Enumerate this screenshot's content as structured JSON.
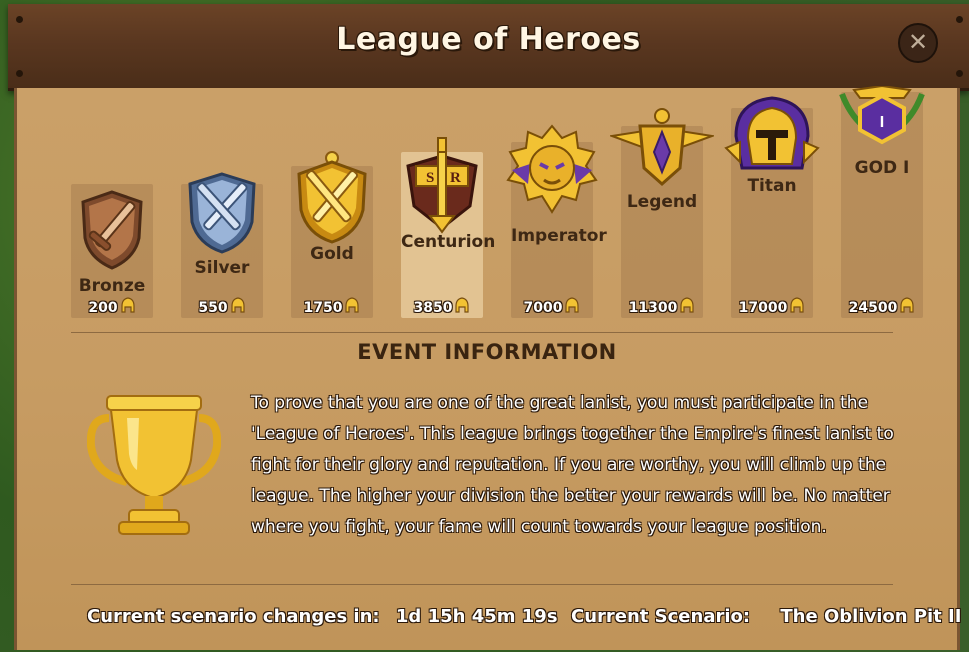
{
  "window": {
    "title": "League of Heroes"
  },
  "ranks": [
    {
      "name": "Bronze",
      "requirement": "200",
      "color": "#a86a42"
    },
    {
      "name": "Silver",
      "requirement": "550",
      "color": "#8aa6cf"
    },
    {
      "name": "Gold",
      "requirement": "1750",
      "color": "#f0c232"
    },
    {
      "name": "Centurion",
      "requirement": "3850",
      "color": "#e9b935",
      "badge_letters": [
        "S",
        "R"
      ]
    },
    {
      "name": "Imperator",
      "requirement": "7000",
      "color": "#f0c232"
    },
    {
      "name": "Legend",
      "requirement": "11300",
      "color": "#f0c232"
    },
    {
      "name": "Titan",
      "requirement": "17000",
      "color": "#f0c232"
    },
    {
      "name": "GOD I",
      "requirement": "24500",
      "color": "#f0c232",
      "badge_numeral": "I"
    }
  ],
  "event": {
    "heading": "EVENT INFORMATION",
    "description": "To prove that you are one of the great lanist, you must participate in the 'League of Heroes'. This league brings together the Empire's finest lanist to fight for their glory and reputation. If you are worthy, you will climb up the league. The higher your division the better your rewards will be. No matter where you fight, your fame will count towards your league position."
  },
  "footer": {
    "timer_label": "Current scenario changes in:",
    "timer_value": "1d 15h 45m 19s",
    "scenario_label": "Current Scenario:",
    "scenario_value": "The Oblivion Pit II"
  },
  "icons": {
    "close": "close-icon",
    "currency": "helmet-icon",
    "trophy": "trophy-icon"
  },
  "colors": {
    "wood": "#5a3720",
    "parchment": "#c79c63",
    "gold": "#f0c232",
    "accent_purple": "#6a3aa8"
  }
}
